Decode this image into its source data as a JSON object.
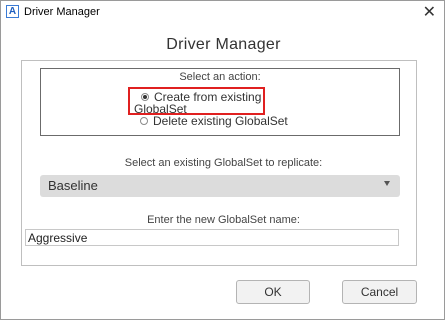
{
  "window": {
    "title": "Driver Manager",
    "app_icon_letter": "A",
    "close_glyph": "✕"
  },
  "dialog": {
    "heading": "Driver Manager",
    "action_prompt": "Select an action:",
    "actions": [
      {
        "label_line1": "Create from existing",
        "label_line2": "GlobalSet",
        "selected": true
      },
      {
        "label": "Delete existing GlobalSet",
        "selected": false
      }
    ],
    "replicate_prompt": "Select an existing GlobalSet to replicate:",
    "replicate_selected": "Baseline",
    "name_prompt": "Enter the new GlobalSet name:",
    "name_value": "Aggressive"
  },
  "buttons": {
    "ok": "OK",
    "cancel": "Cancel"
  },
  "colors": {
    "highlight": "#e02020",
    "dropdown_bg": "#dcdcdc",
    "icon_accent": "#3a7bd5"
  },
  "icons": [
    "app-icon",
    "close-icon",
    "radio-checked-icon",
    "radio-unchecked-icon",
    "chevron-down-icon"
  ]
}
